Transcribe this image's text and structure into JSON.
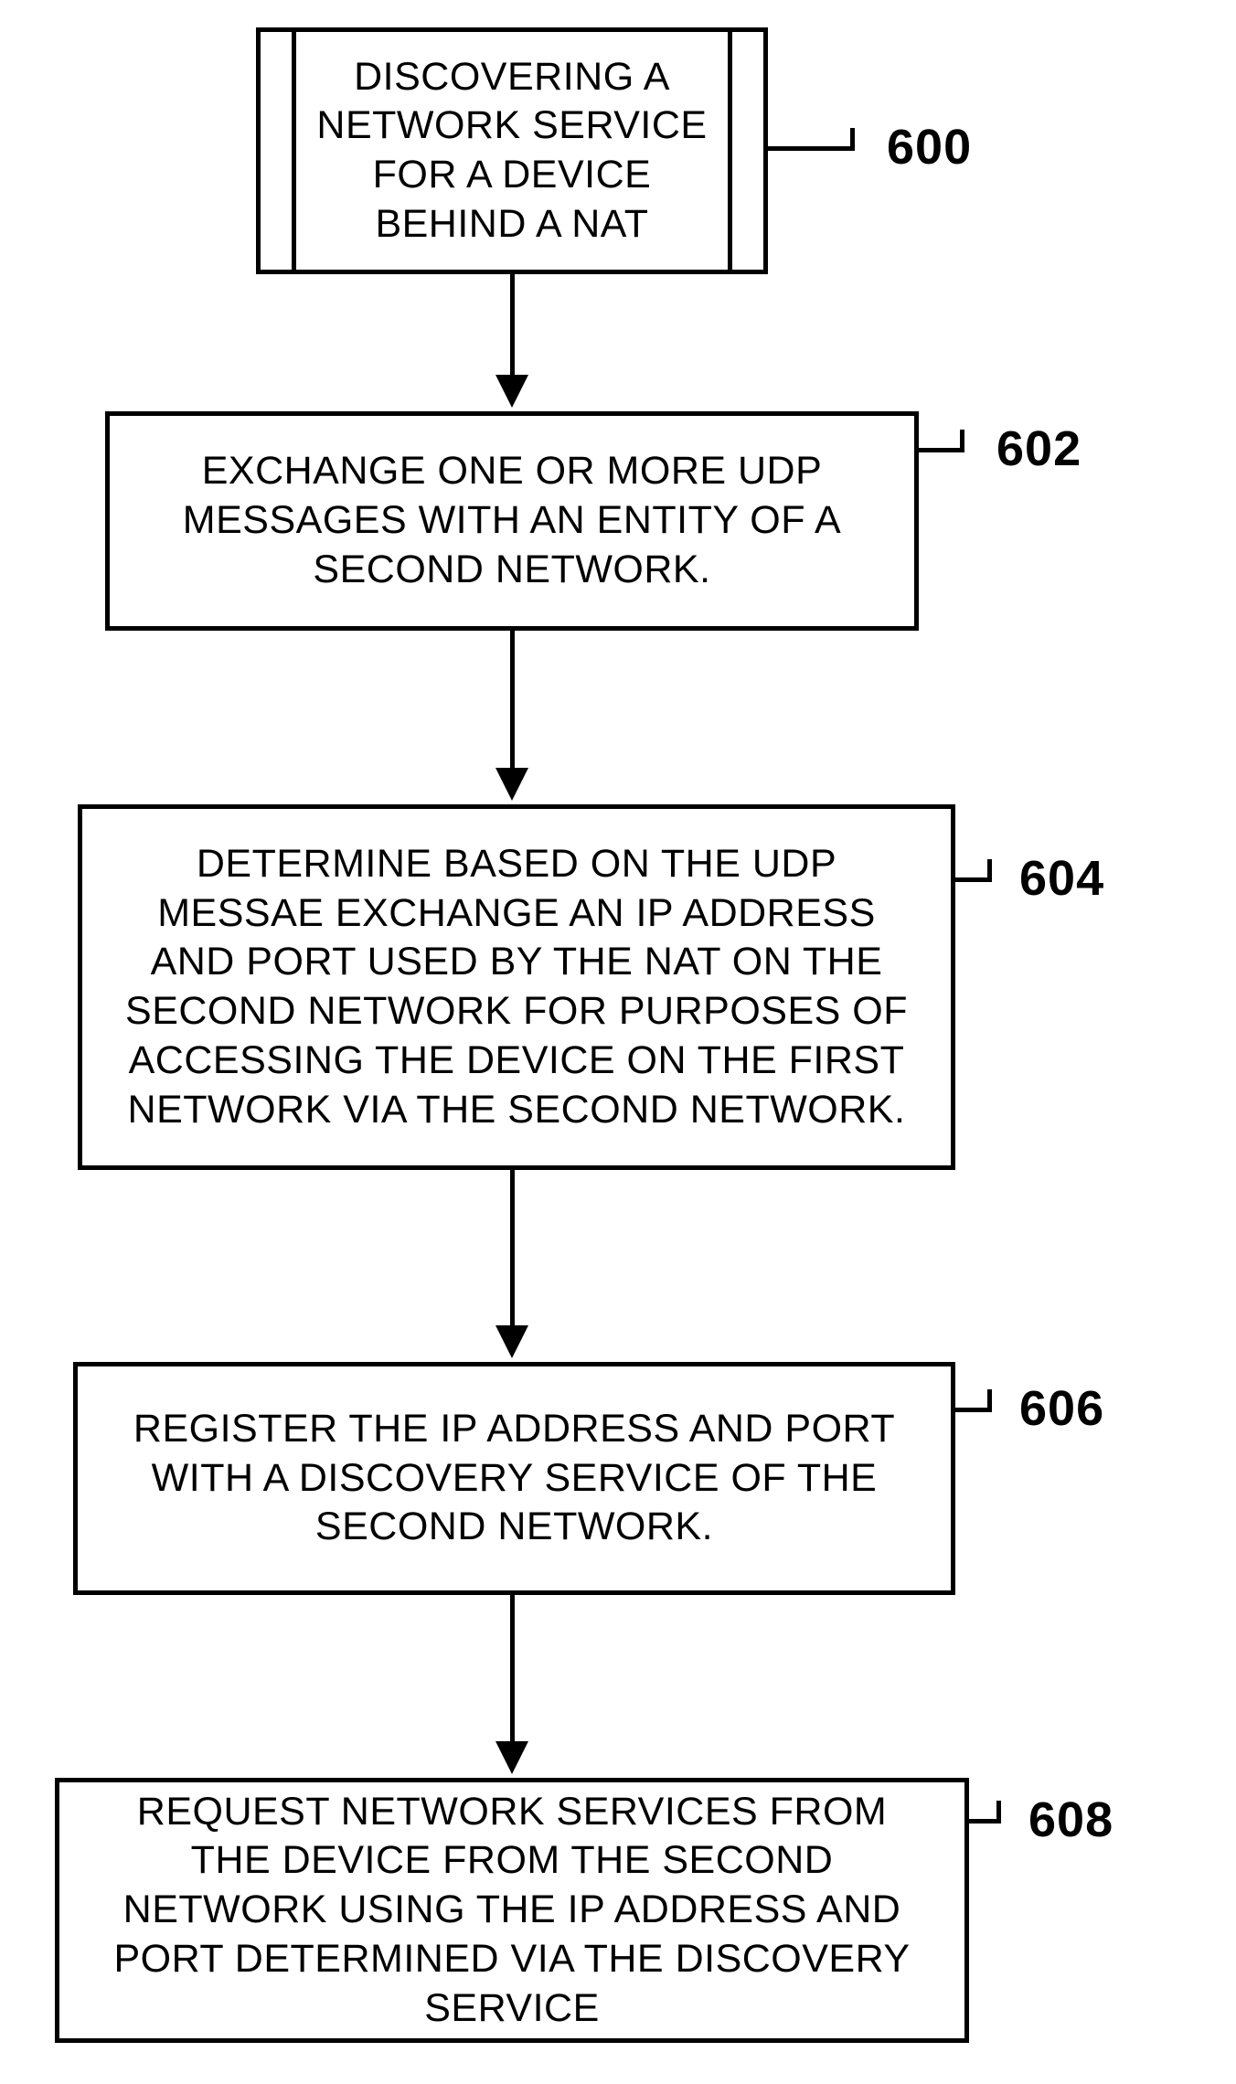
{
  "flow": {
    "steps": [
      {
        "id": "600",
        "type": "terminator",
        "text": "DISCOVERING A NETWORK SERVICE FOR A DEVICE BEHIND A NAT",
        "label": "600"
      },
      {
        "id": "602",
        "type": "process",
        "text": "EXCHANGE ONE OR MORE UDP MESSAGES WITH AN ENTITY OF A SECOND NETWORK.",
        "label": "602"
      },
      {
        "id": "604",
        "type": "process",
        "text": "DETERMINE BASED ON THE UDP MESSAE EXCHANGE AN IP ADDRESS AND PORT USED BY THE NAT ON THE SECOND NETWORK FOR PURPOSES OF ACCESSING THE DEVICE ON THE FIRST NETWORK VIA THE SECOND NETWORK.",
        "label": "604"
      },
      {
        "id": "606",
        "type": "process",
        "text": "REGISTER THE IP ADDRESS AND PORT WITH A DISCOVERY SERVICE OF THE SECOND NETWORK.",
        "label": "606"
      },
      {
        "id": "608",
        "type": "process",
        "text": "REQUEST NETWORK SERVICES FROM THE DEVICE FROM THE SECOND NETWORK USING THE IP ADDRESS AND PORT DETERMINED VIA THE DISCOVERY SERVICE",
        "label": "608"
      }
    ]
  }
}
